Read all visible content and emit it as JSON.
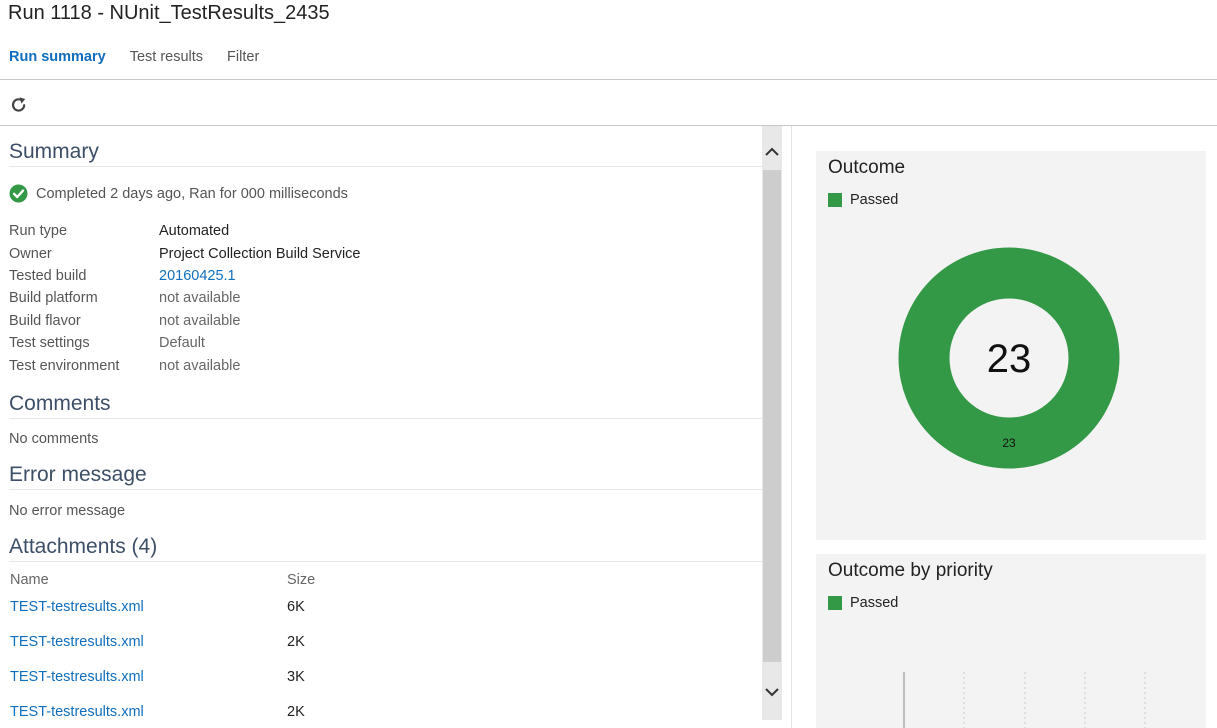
{
  "header": {
    "title": "Run 1118 - NUnit_TestResults_2435"
  },
  "tabs": [
    {
      "label": "Run summary",
      "active": true
    },
    {
      "label": "Test results",
      "active": false
    },
    {
      "label": "Filter",
      "active": false
    }
  ],
  "toolbar": {
    "refresh_icon": "refresh-icon"
  },
  "summary": {
    "title": "Summary",
    "status_icon": "check-circle-icon",
    "status_text": "Completed 2 days ago, Ran for 000 milliseconds",
    "fields": [
      {
        "label": "Run type",
        "value": "Automated"
      },
      {
        "label": "Owner",
        "value": "Project Collection Build Service"
      },
      {
        "label": "Tested build",
        "value": "20160425.1"
      },
      {
        "label": "Build platform",
        "value": "not available"
      },
      {
        "label": "Build flavor",
        "value": "not available"
      },
      {
        "label": "Test settings",
        "value": "Default"
      },
      {
        "label": "Test environment",
        "value": "not available"
      }
    ]
  },
  "comments": {
    "title": "Comments",
    "text": "No comments"
  },
  "error": {
    "title": "Error message",
    "text": "No error message"
  },
  "attachments": {
    "title": "Attachments (4)",
    "columns": [
      "Name",
      "Size"
    ],
    "rows": [
      {
        "name": "TEST-testresults.xml",
        "size": "6K"
      },
      {
        "name": "TEST-testresults.xml",
        "size": "2K"
      },
      {
        "name": "TEST-testresults.xml",
        "size": "3K"
      },
      {
        "name": "TEST-testresults.xml",
        "size": "2K"
      }
    ]
  },
  "outcome_card": {
    "title": "Outcome",
    "legend": "Passed",
    "total": "23",
    "slice_label": "23"
  },
  "priority_card": {
    "title": "Outcome by priority",
    "legend": "Passed"
  },
  "colors": {
    "passed": "#339947",
    "link": "#106ebe",
    "tab_active": "#106ebe",
    "card_bg": "#f3f3f3"
  },
  "chart_data": [
    {
      "type": "pie",
      "title": "Outcome",
      "categories": [
        "Passed"
      ],
      "values": [
        23
      ],
      "center_label": "23",
      "legend": "top-left"
    },
    {
      "type": "bar",
      "title": "Outcome by priority",
      "series": [
        {
          "name": "Passed",
          "values": []
        }
      ],
      "legend": "top-left",
      "grid": true
    }
  ]
}
